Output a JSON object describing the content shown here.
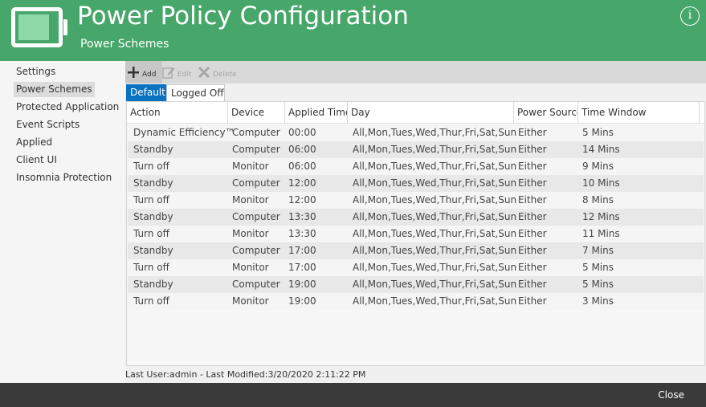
{
  "header": {
    "title": "Power Policy Configuration",
    "subtitle": "Power Schemes",
    "info_glyph": "i",
    "brand_color": "#47a76a"
  },
  "sidebar": {
    "items": [
      {
        "label": "Settings",
        "active": false
      },
      {
        "label": "Power Schemes",
        "active": true
      },
      {
        "label": "Protected Application",
        "active": false
      },
      {
        "label": "Event Scripts",
        "active": false
      },
      {
        "label": "Applied",
        "active": false
      },
      {
        "label": "Client UI",
        "active": false
      },
      {
        "label": "Insomnia Protection",
        "active": false
      }
    ]
  },
  "toolbar": {
    "add_label": "Add",
    "edit_label": "Edit",
    "delete_label": "Delete",
    "icons": [
      "plus-icon",
      "edit-icon",
      "delete-x-icon"
    ]
  },
  "tabs": [
    {
      "label": "Default",
      "active": true
    },
    {
      "label": "Logged Off",
      "active": false
    }
  ],
  "table": {
    "columns": [
      "Action",
      "Device",
      "Applied Time",
      "Day",
      "Power Source",
      "Time Window"
    ],
    "rows": [
      [
        "Dynamic Efficiency™",
        "Computer",
        "00:00",
        "All,Mon,Tues,Wed,Thur,Fri,Sat,Sun",
        "Either",
        "5 Mins"
      ],
      [
        "Standby",
        "Computer",
        "06:00",
        "All,Mon,Tues,Wed,Thur,Fri,Sat,Sun",
        "Either",
        "14 Mins"
      ],
      [
        "Turn off",
        "Monitor",
        "06:00",
        "All,Mon,Tues,Wed,Thur,Fri,Sat,Sun",
        "Either",
        "9 Mins"
      ],
      [
        "Standby",
        "Computer",
        "12:00",
        "All,Mon,Tues,Wed,Thur,Fri,Sat,Sun",
        "Either",
        "10 Mins"
      ],
      [
        "Turn off",
        "Monitor",
        "12:00",
        "All,Mon,Tues,Wed,Thur,Fri,Sat,Sun",
        "Either",
        "8 Mins"
      ],
      [
        "Standby",
        "Computer",
        "13:30",
        "All,Mon,Tues,Wed,Thur,Fri,Sat,Sun",
        "Either",
        "12 Mins"
      ],
      [
        "Turn off",
        "Monitor",
        "13:30",
        "All,Mon,Tues,Wed,Thur,Fri,Sat,Sun",
        "Either",
        "11 Mins"
      ],
      [
        "Standby",
        "Computer",
        "17:00",
        "All,Mon,Tues,Wed,Thur,Fri,Sat,Sun",
        "Either",
        "7 Mins"
      ],
      [
        "Turn off",
        "Monitor",
        "17:00",
        "All,Mon,Tues,Wed,Thur,Fri,Sat,Sun",
        "Either",
        "5 Mins"
      ],
      [
        "Standby",
        "Computer",
        "19:00",
        "All,Mon,Tues,Wed,Thur,Fri,Sat,Sun",
        "Either",
        "5 Mins"
      ],
      [
        "Turn off",
        "Monitor",
        "19:00",
        "All,Mon,Tues,Wed,Thur,Fri,Sat,Sun",
        "Either",
        "3 Mins"
      ]
    ]
  },
  "status_text": "Last User:admin - Last Modified:3/20/2020 2:11:22 PM",
  "footer": {
    "close_label": "Close"
  }
}
